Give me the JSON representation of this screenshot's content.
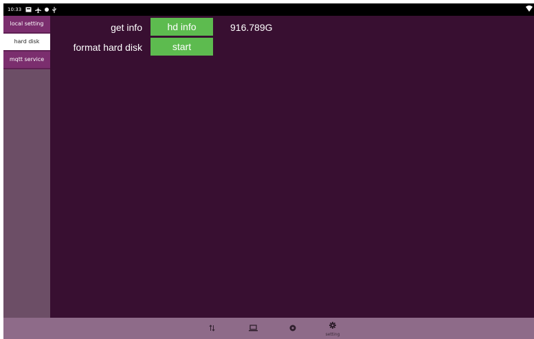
{
  "status_bar": {
    "time": "10:33",
    "icons": [
      "screenshot-icon",
      "plane-icon",
      "dot-icon",
      "usb-icon",
      "wifi-icon"
    ]
  },
  "sidebar": {
    "items": [
      {
        "label": "local setting",
        "active": false
      },
      {
        "label": "hard disk",
        "active": true
      },
      {
        "label": "mqtt service",
        "active": false
      }
    ]
  },
  "main": {
    "get_info": {
      "label": "get info",
      "button": "hd info",
      "value": "916.789G"
    },
    "format": {
      "label": "format hard disk",
      "button": "start"
    }
  },
  "nav_bar": {
    "items": [
      {
        "icon": "transfer-arrows-icon",
        "label": ""
      },
      {
        "icon": "laptop-icon",
        "label": ""
      },
      {
        "icon": "circle-icon",
        "label": ""
      },
      {
        "icon": "gear-icon",
        "label": "setting"
      }
    ]
  },
  "colors": {
    "background": "#380f31",
    "sidebar": "#6c4e66",
    "sidebar_item": "#7b2e6e",
    "button_green": "#5dbb4f",
    "nav_bar": "#8e6b89"
  }
}
